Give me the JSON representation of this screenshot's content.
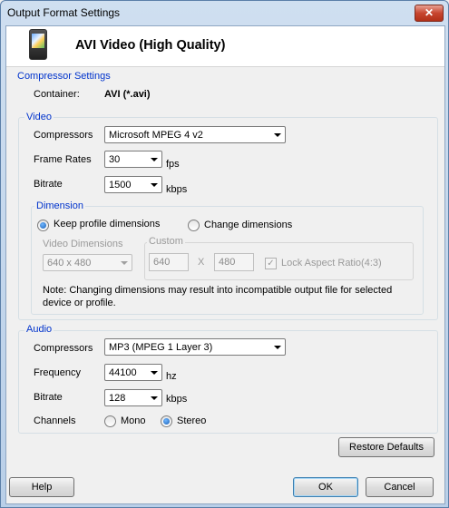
{
  "window": {
    "title": "Output Format Settings",
    "close_glyph": "✕"
  },
  "header": {
    "title": "AVI Video (High Quality)",
    "icon": "device-icon"
  },
  "compressor_settings": {
    "label": "Compressor Settings",
    "container_label": "Container:",
    "container_value": "AVI (*.avi)"
  },
  "video": {
    "label": "Video",
    "compressors_label": "Compressors",
    "compressors_value": "Microsoft MPEG 4 v2",
    "frame_rates_label": "Frame Rates",
    "frame_rates_value": "30",
    "frame_rates_unit": "fps",
    "bitrate_label": "Bitrate",
    "bitrate_value": "1500",
    "bitrate_unit": "kbps"
  },
  "dimension": {
    "label": "Dimension",
    "keep_label": "Keep profile dimensions",
    "keep_selected": true,
    "change_label": "Change dimensions",
    "change_selected": false,
    "video_dimensions_label": "Video Dimensions",
    "video_dimensions_value": "640 x 480",
    "custom_label": "Custom",
    "custom_width": "640",
    "x_label": "X",
    "custom_height": "480",
    "lock_label": "Lock Aspect Ratio(4:3)",
    "lock_checked": true,
    "note": "Note: Changing dimensions may result into incompatible output file for selected device or profile."
  },
  "audio": {
    "label": "Audio",
    "compressors_label": "Compressors",
    "compressors_value": "MP3 (MPEG 1 Layer 3)",
    "frequency_label": "Frequency",
    "frequency_value": "44100",
    "frequency_unit": "hz",
    "bitrate_label": "Bitrate",
    "bitrate_value": "128",
    "bitrate_unit": "kbps",
    "channels_label": "Channels",
    "mono_label": "Mono",
    "mono_selected": false,
    "stereo_label": "Stereo",
    "stereo_selected": true
  },
  "buttons": {
    "restore_defaults": "Restore Defaults",
    "help": "Help",
    "ok": "OK",
    "cancel": "Cancel"
  }
}
